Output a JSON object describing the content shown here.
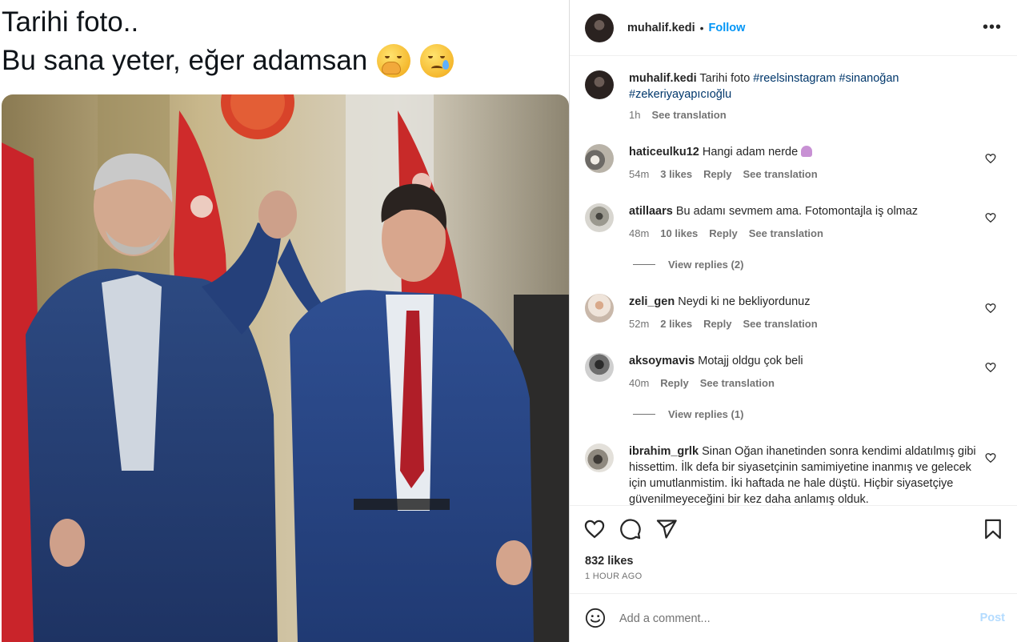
{
  "media": {
    "caption_line1": "Tarihi foto..",
    "caption_line2": "Bu sana yeter, eğer adamsan",
    "emojis": [
      "hand-over-mouth-emoji",
      "crying-face-emoji"
    ]
  },
  "header": {
    "username": "muhalif.kedi",
    "separator": "•",
    "follow_label": "Follow",
    "more_label": "•••"
  },
  "post_caption": {
    "username": "muhalif.kedi",
    "text": "Tarihi foto",
    "hashtags": [
      "#reelsinstagram",
      "#sinanoğan",
      "#zekeriyayapıcıoğlu"
    ],
    "time": "1h",
    "see_translation": "See translation"
  },
  "comments": [
    {
      "username": "haticeulku12",
      "text": "Hangi adam nerde",
      "emoji": "person-shrugging-emoji",
      "time": "54m",
      "likes": "3 likes",
      "reply": "Reply",
      "see_translation": "See translation"
    },
    {
      "username": "atillaars",
      "text": "Bu adamı sevmem ama. Fotomontajla iş olmaz",
      "time": "48m",
      "likes": "10 likes",
      "reply": "Reply",
      "see_translation": "See translation",
      "view_replies": "View replies (2)"
    },
    {
      "username": "zeli_gen",
      "text": "Neydi ki ne bekliyordunuz",
      "time": "52m",
      "likes": "2 likes",
      "reply": "Reply",
      "see_translation": "See translation"
    },
    {
      "username": "aksoymavis",
      "text": "Motajj oldgu çok beli",
      "time": "40m",
      "reply": "Reply",
      "see_translation": "See translation",
      "view_replies": "View replies (1)"
    },
    {
      "username": "ibrahim_grlk",
      "text": "Sinan Oğan ihanetinden sonra kendimi aldatılmış gibi hissettim. İlk defa bir siyasetçinin samimiyetine inanmış ve gelecek için umutlanmistim. İki haftada ne hale düştü. Hiçbir siyasetçiye güvenilmeyeceğini bir kez daha anlamış olduk."
    }
  ],
  "actions": {
    "likes": "832 likes",
    "time_ago": "1 HOUR AGO",
    "icons": [
      "heart-icon",
      "comment-icon",
      "share-icon",
      "bookmark-icon"
    ]
  },
  "add_comment": {
    "placeholder": "Add a comment...",
    "post_label": "Post"
  },
  "colors": {
    "link_blue": "#0095f6",
    "hashtag": "#00376b",
    "muted": "#737373",
    "post_disabled": "#b3dbff"
  }
}
